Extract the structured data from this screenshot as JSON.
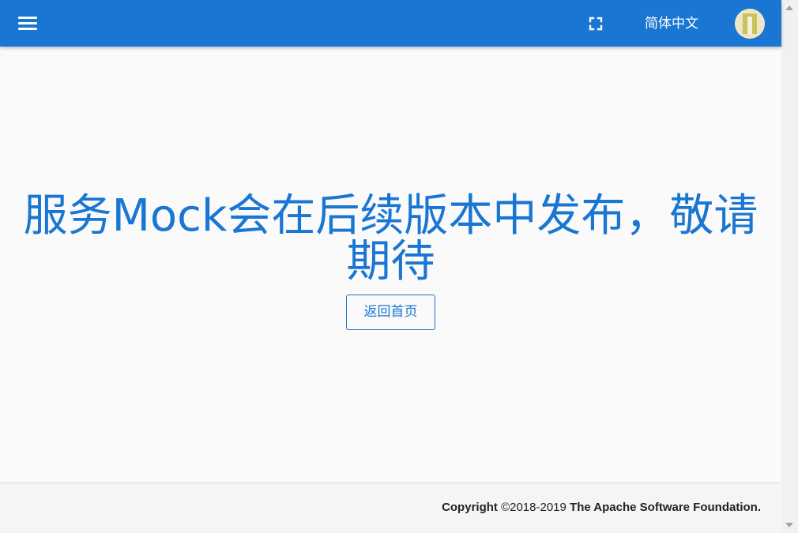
{
  "toolbar": {
    "background": "#1976d2",
    "menu_icon": "hamburger-menu-icon",
    "fullscreen_icon": "fullscreen-icon",
    "language_label": "简体中文",
    "avatar_icon": "user-avatar"
  },
  "main": {
    "headline": "服务Mock会在后续版本中发布，敬请期待",
    "home_button_label": "返回首页",
    "accent_color": "#1976d2"
  },
  "footer": {
    "copyright_label": "Copyright",
    "years": "©2018-2019",
    "organization": "The Apache Software Foundation."
  }
}
